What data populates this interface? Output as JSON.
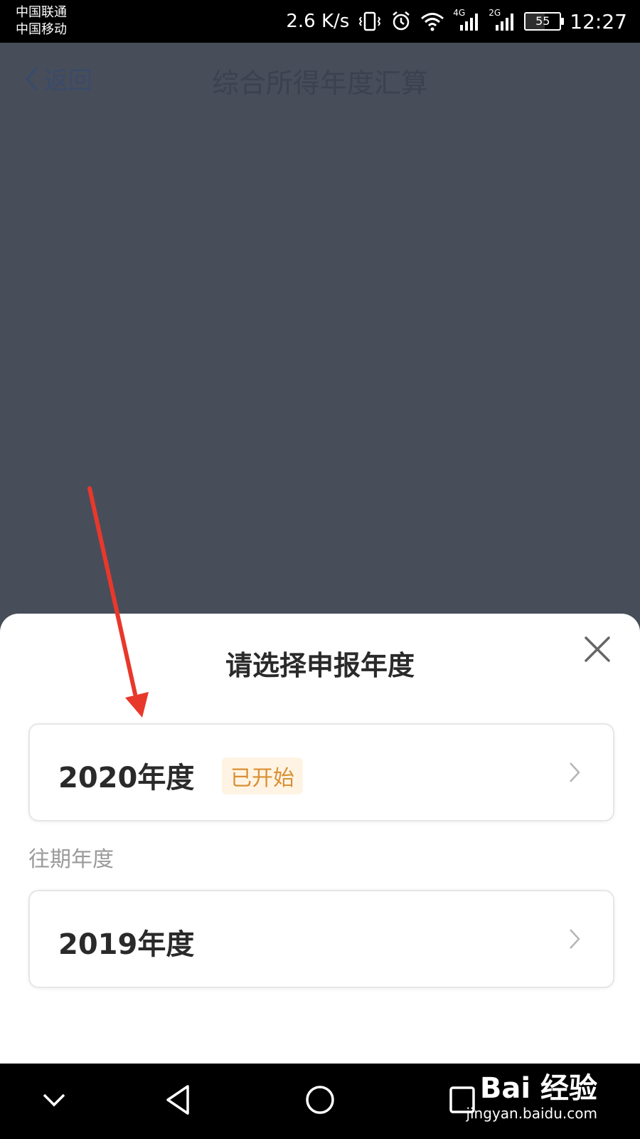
{
  "status_bar": {
    "carrier_1": "中国联通",
    "carrier_2": "中国移动",
    "network_speed": "2.6 K/s",
    "signal_1_label": "4G",
    "signal_2_label": "2G",
    "battery": "55",
    "time": "12:27"
  },
  "header": {
    "back_label": "返回",
    "title": "综合所得年度汇算"
  },
  "sheet": {
    "title": "请选择申报年度",
    "current": {
      "year": "2020年度",
      "badge": "已开始"
    },
    "past_label": "往期年度",
    "past": {
      "year": "2019年度"
    }
  },
  "watermark": {
    "brand": "Bai 经验",
    "site": "jingyan.baidu.com"
  },
  "colors": {
    "overlay": "#484d5a",
    "badge_text": "#d99034",
    "badge_bg": "#fff4e4",
    "arrow": "#e8382b"
  }
}
